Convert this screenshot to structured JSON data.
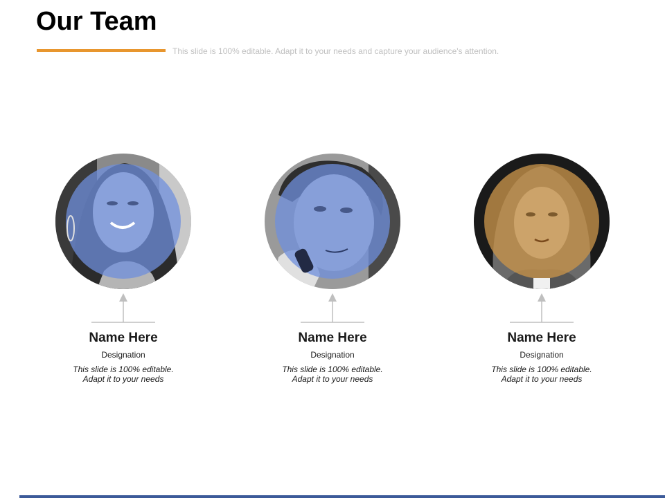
{
  "slide": {
    "title": "Our Team",
    "subtitle": "This slide is 100% editable. Adapt it to your needs and capture your audience's attention."
  },
  "colors": {
    "accent": "#e8962e",
    "bottom_bar": "#3c5a99",
    "blue_overlay": "#6f8fdc",
    "gold_overlay": "#c8944a",
    "connector": "#bfbfbf"
  },
  "members": [
    {
      "name": "Name Here",
      "designation": "Designation",
      "desc_line1": "This slide is 100% editable.",
      "desc_line2": "Adapt it to your needs"
    },
    {
      "name": "Name Here",
      "designation": "Designation",
      "desc_line1": "This slide is 100% editable.",
      "desc_line2": "Adapt it to your needs"
    },
    {
      "name": "Name Here",
      "designation": "Designation",
      "desc_line1": "This slide is 100% editable.",
      "desc_line2": "Adapt it to your needs"
    }
  ]
}
